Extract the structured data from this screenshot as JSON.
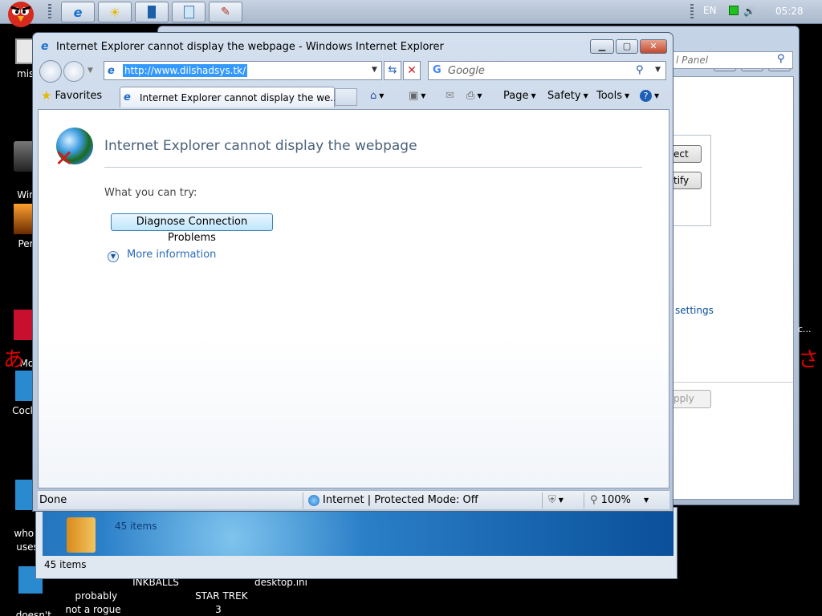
{
  "taskbar": {
    "language": "EN",
    "time": "05:28"
  },
  "desktop": {
    "icons": [
      {
        "label": "mist"
      },
      {
        "label": "Winc\nVis"
      },
      {
        "label": "Per"
      },
      {
        "label": "Mor\nRea"
      },
      {
        "label": "CockC"
      },
      {
        "label": "who th\nuses"
      },
      {
        "label": "doesn't\nwork lol"
      },
      {
        "label": "probably\nnot a rogue"
      },
      {
        "label": "INKBALLS"
      },
      {
        "label": "STAR TREK\n3"
      },
      {
        "label": "desktop.ini"
      }
    ],
    "jp_left": "あ",
    "jp_right": "さ"
  },
  "bg_explorer": {
    "items_top": "45 items",
    "items_status": "45 items"
  },
  "control_panel": {
    "search_placeholder": "l Panel",
    "btn1": "ect",
    "btn2": "tify",
    "settings_link": "settings",
    "apply": "pply",
    "right_text": "c..."
  },
  "ie": {
    "title": "Internet Explorer cannot display the webpage - Windows Internet Explorer",
    "address": "http://www.dilshadsys.tk/",
    "search_placeholder": "Google",
    "favorites": "Favorites",
    "tab_label": "Internet Explorer cannot display the we...",
    "page_menu": "Page",
    "safety_menu": "Safety",
    "tools_menu": "Tools",
    "error_title": "Internet Explorer cannot display the webpage",
    "try_label": "What you can try:",
    "diagnose_button": "Diagnose Connection Problems",
    "more_info": "More information",
    "status_done": "Done",
    "status_zone": "Internet | Protected Mode: Off",
    "zoom": "100%"
  },
  "colors": {
    "link": "#2c6ab7",
    "title_text": "#4a607b",
    "address_highlight": "#3399ff"
  }
}
